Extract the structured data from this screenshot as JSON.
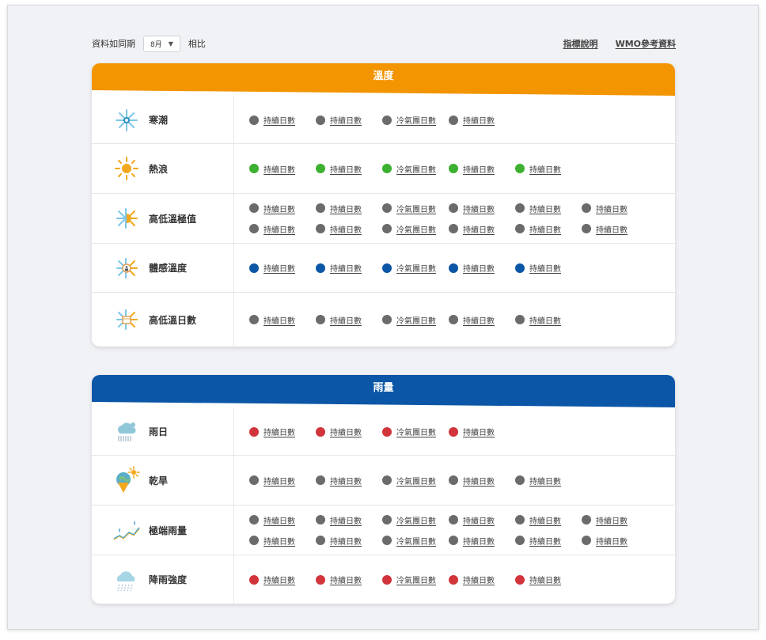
{
  "toolbar": {
    "compare_label": "資料如同期",
    "month_value": "8月",
    "compare_suffix": "相比",
    "link_guide": "指標說明",
    "link_wmo": "WMO參考資料"
  },
  "colors": {
    "temperature_header": "#f29500",
    "rain_header": "#0b56a6",
    "gray_dot": "#6b6b6b",
    "green_dot": "#3cb030",
    "blue_dot": "#0b56a6",
    "red_dot": "#d1343a"
  },
  "temperature": {
    "title": "溫度",
    "rows": [
      {
        "label": "寒潮",
        "icon": "snowflake-icon",
        "color": "gray",
        "lines": [
          [
            "持續日數",
            "持續日數",
            "冷氣團日數",
            "持續日數"
          ]
        ]
      },
      {
        "label": "熱浪",
        "icon": "sun-icon",
        "color": "green",
        "lines": [
          [
            "持續日數",
            "持續日數",
            "冷氣團日數",
            "持續日數",
            "持續日數"
          ]
        ]
      },
      {
        "label": "高低溫極值",
        "icon": "sun-snow-icon",
        "color": "gray",
        "lines": [
          [
            "持續日數",
            "持續日數",
            "冷氣團日數",
            "持續日數",
            "持續日數",
            "持續日數"
          ],
          [
            "持續日數",
            "持續日數",
            "冷氣團日數",
            "持續日數",
            "持續日數",
            "持續日數"
          ]
        ]
      },
      {
        "label": "體感溫度",
        "icon": "feels-like-icon",
        "color": "blue",
        "lines": [
          [
            "持續日數",
            "持續日數",
            "冷氣團日數",
            "持續日數",
            "持續日數"
          ]
        ]
      },
      {
        "label": "高低溫日數",
        "icon": "calendar-sun-icon",
        "color": "gray",
        "lines": [
          [
            "持續日數",
            "持續日數",
            "冷氣團日數",
            "持續日數",
            "持續日數"
          ]
        ]
      }
    ]
  },
  "rain": {
    "title": "雨量",
    "rows": [
      {
        "label": "雨日",
        "icon": "rain-cloud-icon",
        "color": "red",
        "lines": [
          [
            "持續日數",
            "持續日數",
            "冷氣團日數",
            "持續日數"
          ]
        ]
      },
      {
        "label": "乾旱",
        "icon": "drought-icon",
        "color": "gray",
        "lines": [
          [
            "持續日數",
            "持續日數",
            "冷氣團日數",
            "持續日數",
            "持續日數"
          ]
        ]
      },
      {
        "label": "極端雨量",
        "icon": "extreme-rain-icon",
        "color": "gray",
        "lines": [
          [
            "持續日數",
            "持續日數",
            "冷氣團日數",
            "持續日數",
            "持續日數",
            "持續日數"
          ],
          [
            "持續日數",
            "持續日數",
            "冷氣團日數",
            "持續日數",
            "持續日數",
            "持續日數"
          ]
        ]
      },
      {
        "label": "降雨強度",
        "icon": "rain-intensity-icon",
        "color": "red",
        "lines": [
          [
            "持續日數",
            "持續日數",
            "冷氣團日數",
            "持續日數",
            "持續日數"
          ]
        ]
      }
    ]
  }
}
